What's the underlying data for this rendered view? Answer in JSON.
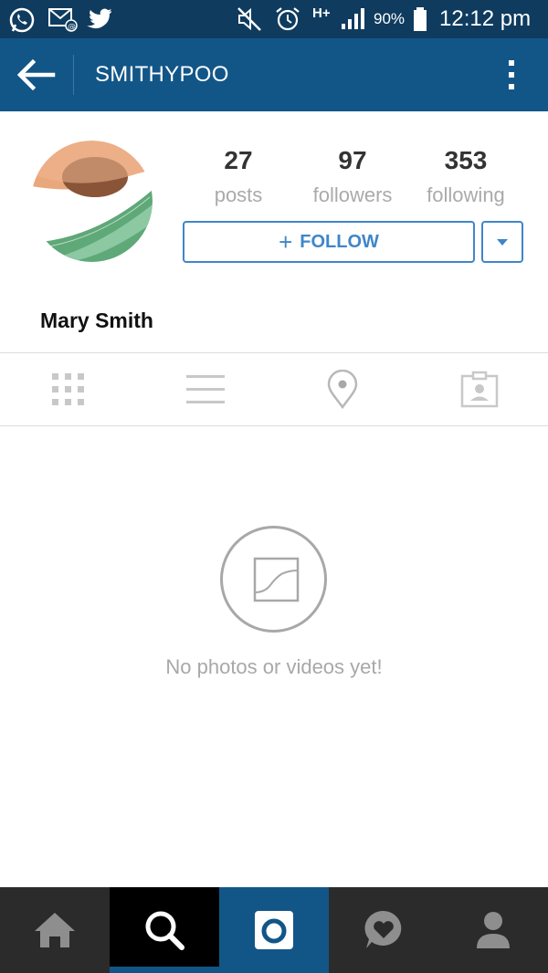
{
  "status_bar": {
    "icons": [
      "whatsapp-icon",
      "email-icon",
      "twitter-icon",
      "mute-icon",
      "alarm-icon",
      "hplus-icon",
      "signal-icon",
      "battery-icon"
    ],
    "network": "H+",
    "battery_percent": "90%",
    "time": "12:12 pm"
  },
  "header": {
    "title": "SMITHYPOO",
    "back_icon": "arrow-left-icon",
    "menu_icon": "more-vertical-icon"
  },
  "profile": {
    "name": "Mary Smith",
    "stats": [
      {
        "count": "27",
        "label": "posts"
      },
      {
        "count": "97",
        "label": "followers"
      },
      {
        "count": "353",
        "label": "following"
      }
    ],
    "follow_label": "FOLLOW",
    "follow_plus": "+"
  },
  "view_tabs": [
    "grid-icon",
    "list-icon",
    "location-pin-icon",
    "tagged-person-icon"
  ],
  "empty_state": {
    "icon": "photo-icon",
    "text": "No photos or videos yet!"
  },
  "bottom_nav": {
    "items": [
      "home-icon",
      "search-icon",
      "camera-icon",
      "activity-heart-icon",
      "profile-icon"
    ],
    "active_index": 1
  },
  "colors": {
    "status_bar": "#0f3b5f",
    "header": "#125688",
    "accent": "#3f86c9",
    "nav_background": "#2b2b2b"
  }
}
